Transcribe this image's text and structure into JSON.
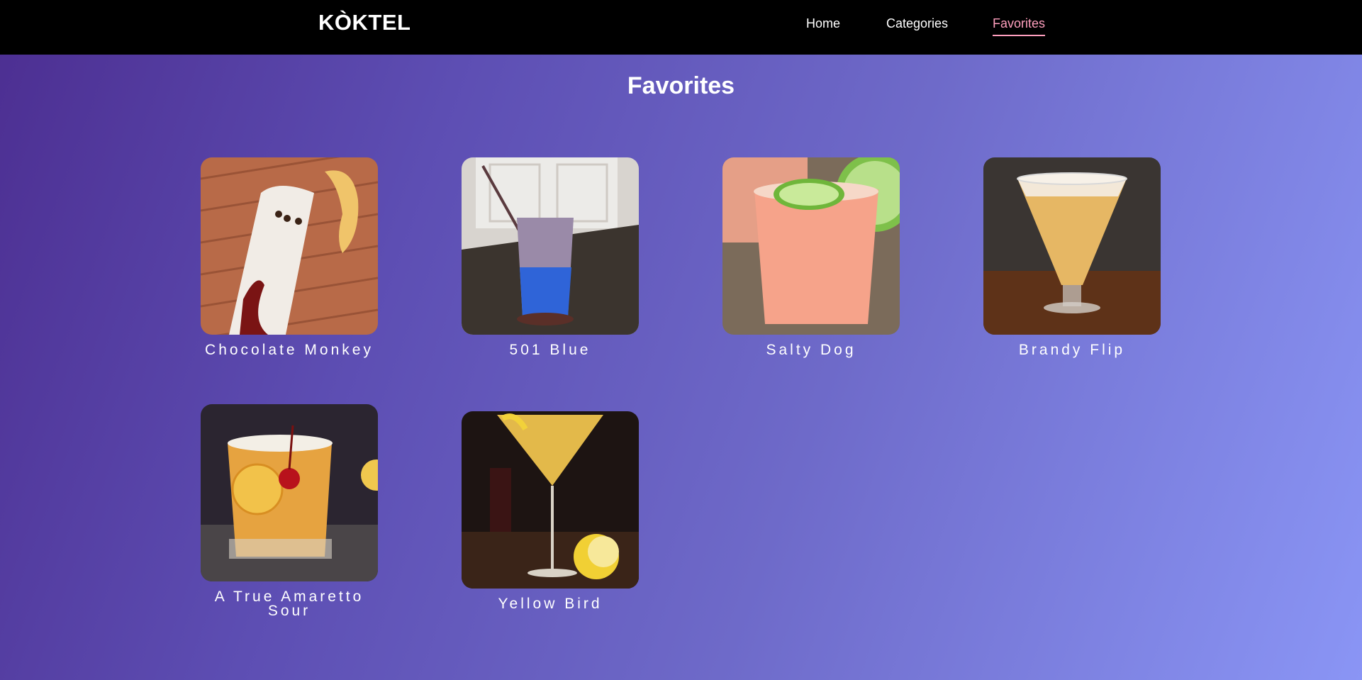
{
  "nav": {
    "brand": "KÒKTEL",
    "links": [
      {
        "label": "Home",
        "active": false
      },
      {
        "label": "Categories",
        "active": false
      },
      {
        "label": "Favorites",
        "active": true
      }
    ]
  },
  "page": {
    "title": "Favorites"
  },
  "favorites": [
    {
      "name": "Chocolate Monkey"
    },
    {
      "name": "501 Blue"
    },
    {
      "name": "Salty Dog"
    },
    {
      "name": "Brandy Flip"
    },
    {
      "name": "A True Amaretto Sour"
    },
    {
      "name": "Yellow Bird"
    }
  ],
  "colors": {
    "nav_bg": "#000000",
    "active_link": "#ff9fbe",
    "gradient_start": "#4c2e91",
    "gradient_end": "#8a95f5"
  }
}
